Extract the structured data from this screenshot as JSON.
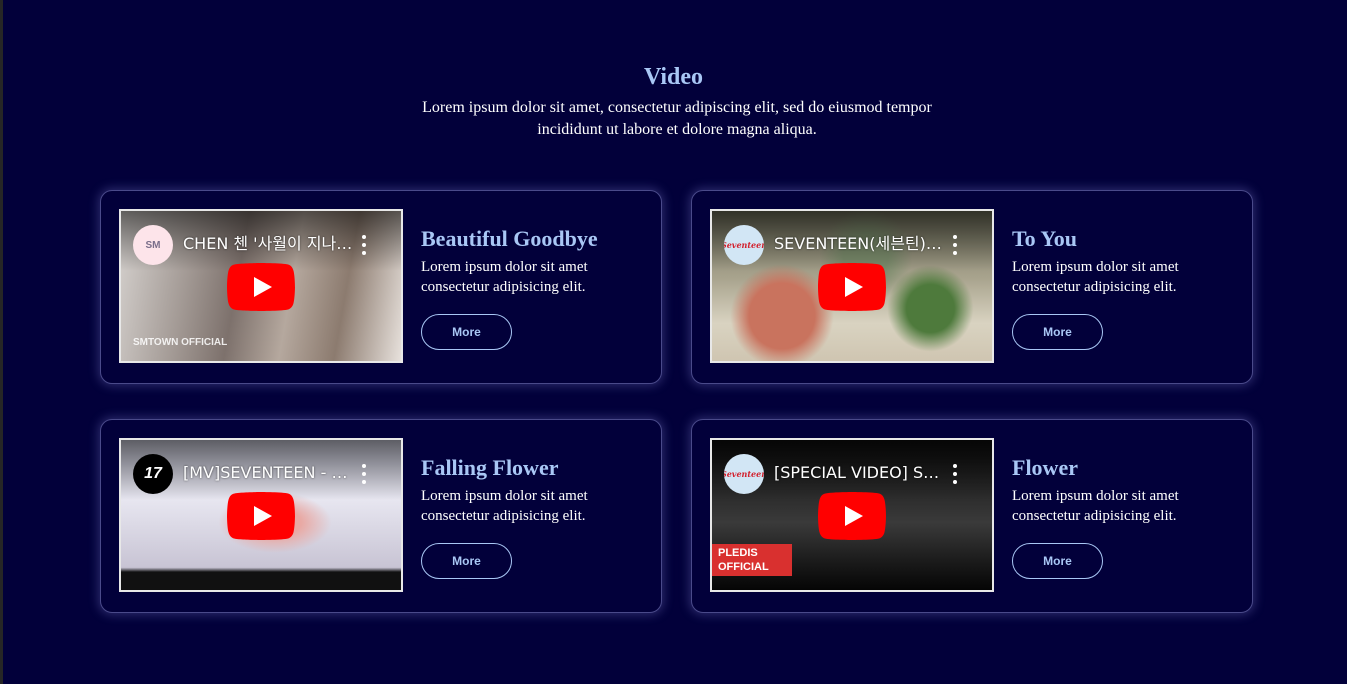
{
  "section": {
    "title": "Video",
    "description": "Lorem ipsum dolor sit amet, consectetur adipiscing elit, sed do eiusmod tempor incididunt ut labore et dolore magna aliqua."
  },
  "colors": {
    "page_background": "#02003a",
    "accent": "#a9c7f5",
    "youtube_red": "#ff0000"
  },
  "cards": [
    {
      "title": "Beautiful Goodbye",
      "text": "Lorem ipsum dolor sit amet consectetur adipisicing elit.",
      "button": "More",
      "video": {
        "title": "CHEN 첸 '사월이 지나면 우리 헤어져요'",
        "channel_logo_text": "SM",
        "watermark": "SMTOWN OFFICIAL"
      }
    },
    {
      "title": "To You",
      "text": "Lorem ipsum dolor sit amet consectetur adipisicing elit.",
      "button": "More",
      "video": {
        "title": "SEVENTEEN(세븐틴) 'To You'",
        "channel_logo_text": "Seventeen"
      }
    },
    {
      "title": "Falling Flower",
      "text": "Lorem ipsum dolor sit amet consectetur adipisicing elit.",
      "button": "More",
      "video": {
        "title": "[MV]SEVENTEEN - 舞い落ちる花びら",
        "channel_logo_text": "17"
      }
    },
    {
      "title": "Flower",
      "text": "Lorem ipsum dolor sit amet consectetur adipisicing elit.",
      "button": "More",
      "video": {
        "title": "[SPECIAL VIDEO] SEVENTEEN - Flower",
        "channel_logo_text": "Seventeen",
        "watermark": "PLEDIS OFFICIAL"
      }
    }
  ]
}
